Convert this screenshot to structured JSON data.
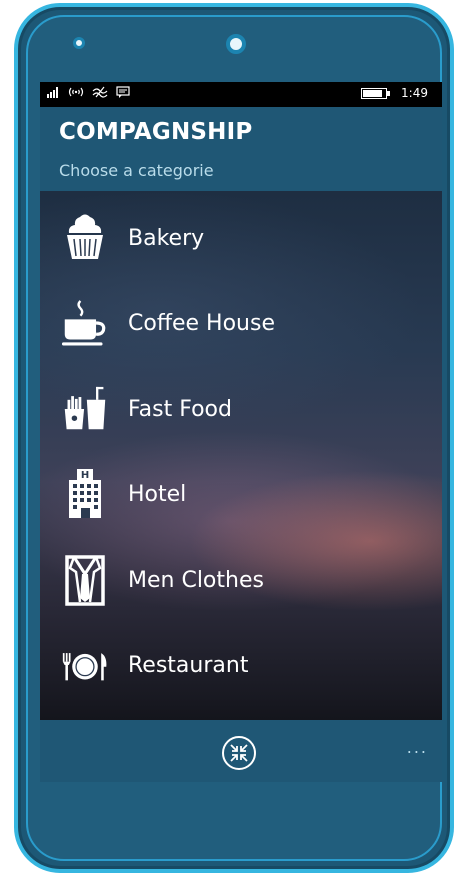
{
  "status_bar": {
    "time": "1:49",
    "icons": [
      "signal-icon",
      "wifi-icon",
      "data-sense-icon",
      "message-icon",
      "battery-icon"
    ],
    "battery_level": 0.8
  },
  "header": {
    "title": "COMPAGNSHIP",
    "subtitle": "Choose a categorie"
  },
  "categories": [
    {
      "label": "Bakery",
      "icon": "cupcake-icon"
    },
    {
      "label": "Coffee House",
      "icon": "coffee-cup-icon"
    },
    {
      "label": "Fast Food",
      "icon": "fast-food-icon"
    },
    {
      "label": "Hotel",
      "icon": "hotel-building-icon"
    },
    {
      "label": "Men Clothes",
      "icon": "suit-icon"
    },
    {
      "label": "Restaurant",
      "icon": "plate-cutlery-icon"
    }
  ],
  "app_bar": {
    "primary_button_icon": "compress-arrows-icon",
    "more_label": "..."
  },
  "colors": {
    "header_bg": "#1f5775",
    "subtitle": "#b9dcea",
    "phone_frame": "#1d5876",
    "phone_outline": "#36b6e0"
  }
}
